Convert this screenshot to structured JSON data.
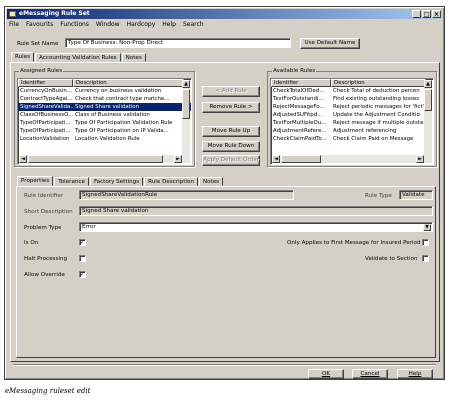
{
  "window": {
    "title": "eMessaging Rule Set",
    "minimize": "_",
    "maximize": "□",
    "close": "×"
  },
  "menu": [
    "File",
    "Favourits",
    "Functions",
    "Window",
    "Hardcopy",
    "Help",
    "Search"
  ],
  "rule_set": {
    "label": "Rule Set Name",
    "value": "Type Of Business: Non-Prop Direct",
    "default_button": "Use Default Name"
  },
  "top_tabs": [
    "Rules",
    "Accounting Validation Rules",
    "Notes"
  ],
  "assigned": {
    "title": "Assigned Rules",
    "columns": [
      "Identifier",
      "Description"
    ],
    "rows": [
      [
        "CurrencyOnBusin...",
        "Currency on business validation"
      ],
      [
        "ContractTypeAgai...",
        "Check that contract type matche..."
      ],
      [
        "SignedShareValida...",
        "Signed Share validation"
      ],
      [
        "ClassOfBusinessO...",
        "Class of Business validation"
      ],
      [
        "TypeOfParticipati...",
        "Type Of Participation Validation Rule"
      ],
      [
        "TypeOfParticipati...",
        "Type Of Participation on IP Valida..."
      ],
      [
        "LocationValidation",
        "Location Validation Rule"
      ]
    ],
    "selected_index": 2
  },
  "middle_buttons": {
    "add": "< Add Rule",
    "remove": "Remove Rule >",
    "up": "Move Rule Up",
    "down": "Move Rule Down",
    "apply_default": "Apply Default Order"
  },
  "available": {
    "title": "Available Rules",
    "columns": [
      "Identifier",
      "Description"
    ],
    "rows": [
      [
        "CheckTotalOfDed...",
        "Check Total of deduction percen"
      ],
      [
        "TestForOutstandi...",
        "Find existing outstanding losses"
      ],
      [
        "RejectMessageFo...",
        "Reject periodic messages for 'fict'"
      ],
      [
        "AdjustedSUFitpd...",
        "Update the Adjustment Conditio"
      ],
      [
        "TestForMultipleOu...",
        "Reject message if multiple outsta"
      ],
      [
        "AdjustmentRefere...",
        "Adjustment referencing"
      ],
      [
        "CheckClaimPaidTo...",
        "Check Claim Paid on Message"
      ]
    ]
  },
  "detail_tabs": [
    "Properties",
    "Tolerance",
    "Factory Settings",
    "Rule Description",
    "Notes"
  ],
  "properties": {
    "rule_identifier_label": "Rule Identifier",
    "rule_identifier_value": "SignedShareValidationRule",
    "rule_type_label": "Rule Type",
    "rule_type_value": "Validate",
    "short_desc_label": "Short Description",
    "short_desc_value": "Signed Share validation",
    "problem_type_label": "Problem Type",
    "problem_type_value": "Error",
    "is_on_label": "Is On",
    "is_on": "✓",
    "halt_label": "Halt Processing",
    "allow_override_label": "Allow Override",
    "allow_override": "✓",
    "first_message_label": "Only Applies to First Message for Insured Period",
    "validate_section_label": "Validate to Section"
  },
  "footer": {
    "ok": "OK",
    "cancel": "Cancel",
    "help": "Help"
  },
  "caption": "eMessaging ruleset edit"
}
